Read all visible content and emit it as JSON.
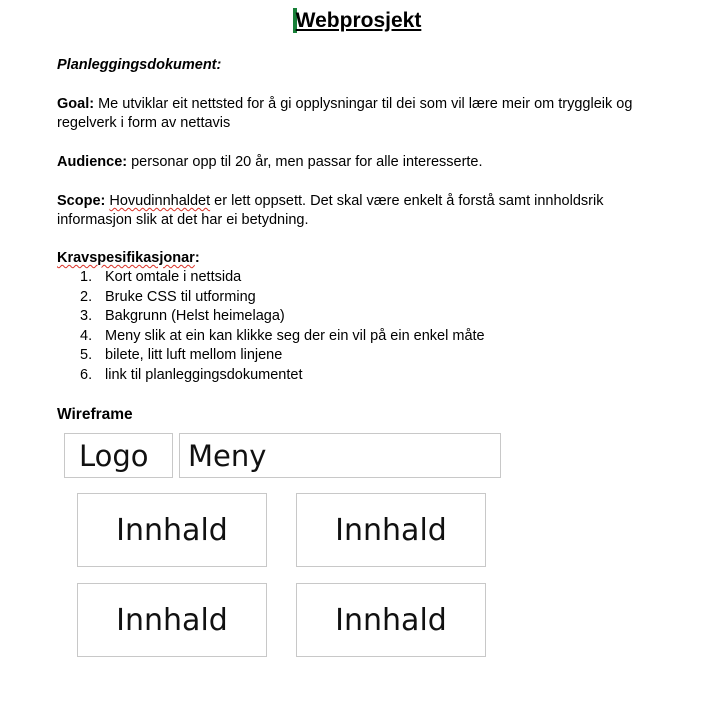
{
  "title": "Webprosjekt",
  "subtitle": "Planleggingsdokument:",
  "goal": {
    "label": "Goal:",
    "text": " Me utviklar eit nettsted for å gi opplysningar til dei som vil lære meir om tryggleik og regelverk i form av nettavis"
  },
  "audience": {
    "label": "Audience:",
    "text": " personar opp til 20 år, men passar for alle interesserte."
  },
  "scope": {
    "label": "Scope:",
    "word": "Hovudinnhaldet",
    "text": " er lett oppsett. Det skal være enkelt å forstå samt innholdsrik informasjon slik at det har ei betydning."
  },
  "requirements": {
    "heading": "Kravspesifikasjonar",
    "colon": ":",
    "items": [
      {
        "num": "1.",
        "text": "Kort omtale i nettsida"
      },
      {
        "num": "2.",
        "text": "Bruke CSS til utforming"
      },
      {
        "num": "3.",
        "text": "Bakgrunn (Helst heimelaga)"
      },
      {
        "num": "4.",
        "text": "Meny slik at ein kan klikke seg der ein vil på ein enkel måte"
      },
      {
        "num": "5.",
        "text": "bilete, litt luft mellom linjene"
      },
      {
        "num": "6.",
        "text": "link til planleggingsdokumentet"
      }
    ]
  },
  "wireframe": {
    "heading": "Wireframe",
    "logo": "Logo",
    "menu": "Meny",
    "content": [
      "Innhald",
      "Innhald",
      "Innhald",
      "Innhald"
    ]
  },
  "colors": {
    "cursor": "#188038",
    "spellcheck": "#d93025",
    "box_border": "#c8c8c8"
  }
}
